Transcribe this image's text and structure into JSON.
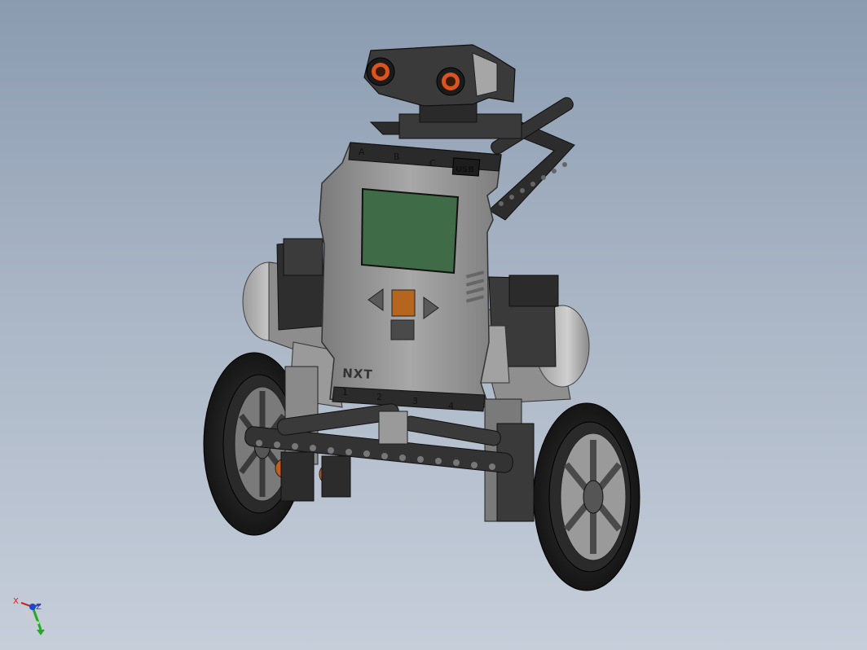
{
  "model": {
    "brand": "NXT",
    "input_ports": [
      "1",
      "2",
      "3",
      "4"
    ],
    "output_ports": [
      "A",
      "B",
      "C"
    ],
    "usb_label": "USB"
  },
  "triad": {
    "x_label": "X",
    "z_label": "Z"
  },
  "colors": {
    "background_top": "#8a9bb0",
    "background_bottom": "#c6ceda",
    "brick_body": "#8c8c8c",
    "screen": "#3f6b46",
    "enter_button": "#b5651d",
    "sensor_eyes": "#d9541e",
    "triad_x": "#cc2222",
    "triad_y": "#22aa22",
    "triad_z": "#2244cc"
  }
}
